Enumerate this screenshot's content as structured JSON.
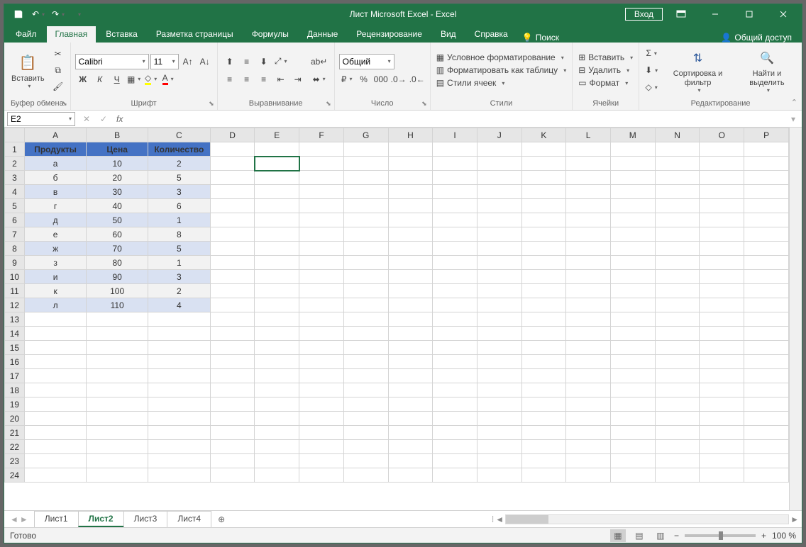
{
  "title": "Лист Microsoft Excel  -  Excel",
  "signin": "Вход",
  "tabs": [
    "Файл",
    "Главная",
    "Вставка",
    "Разметка страницы",
    "Формулы",
    "Данные",
    "Рецензирование",
    "Вид",
    "Справка"
  ],
  "active_tab": 1,
  "search": "Поиск",
  "share": "Общий доступ",
  "ribbon": {
    "clipboard": {
      "paste": "Вставить",
      "label": "Буфер обмена"
    },
    "font": {
      "name": "Calibri",
      "size": "11",
      "label": "Шрифт",
      "bold": "Ж",
      "italic": "К",
      "underline": "Ч"
    },
    "alignment": {
      "label": "Выравнивание"
    },
    "number": {
      "format": "Общий",
      "label": "Число"
    },
    "styles": {
      "cond": "Условное форматирование",
      "table": "Форматировать как таблицу",
      "cell": "Стили ячеек",
      "label": "Стили"
    },
    "cells": {
      "insert": "Вставить",
      "delete": "Удалить",
      "format": "Формат",
      "label": "Ячейки"
    },
    "editing": {
      "sort": "Сортировка и фильтр",
      "find": "Найти и выделить",
      "label": "Редактирование"
    }
  },
  "name_box": "E2",
  "columns": [
    "A",
    "B",
    "C",
    "D",
    "E",
    "F",
    "G",
    "H",
    "I",
    "J",
    "K",
    "L",
    "M",
    "N",
    "O",
    "P"
  ],
  "rows": [
    "1",
    "2",
    "3",
    "4",
    "5",
    "6",
    "7",
    "8",
    "9",
    "10",
    "11",
    "12",
    "13",
    "14",
    "15",
    "16",
    "17",
    "18",
    "19",
    "20",
    "21",
    "22",
    "23",
    "24"
  ],
  "table_headers": [
    "Продукты",
    "Цена",
    "Количество"
  ],
  "table_data": [
    [
      "а",
      "10",
      "2"
    ],
    [
      "б",
      "20",
      "5"
    ],
    [
      "в",
      "30",
      "3"
    ],
    [
      "г",
      "40",
      "6"
    ],
    [
      "д",
      "50",
      "1"
    ],
    [
      "е",
      "60",
      "8"
    ],
    [
      "ж",
      "70",
      "5"
    ],
    [
      "з",
      "80",
      "1"
    ],
    [
      "и",
      "90",
      "3"
    ],
    [
      "к",
      "100",
      "2"
    ],
    [
      "л",
      "110",
      "4"
    ]
  ],
  "selected_cell": {
    "row": 2,
    "col": "E"
  },
  "sheets": [
    "Лист1",
    "Лист2",
    "Лист3",
    "Лист4"
  ],
  "active_sheet": 1,
  "status": "Готово",
  "zoom": "100 %"
}
